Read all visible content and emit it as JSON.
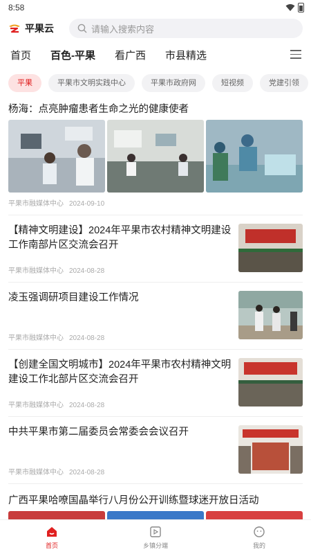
{
  "status": {
    "time": "8:58"
  },
  "app": {
    "name": "平果云"
  },
  "search": {
    "placeholder": "请输入搜索内容"
  },
  "nav_tabs": [
    {
      "label": "首页"
    },
    {
      "label": "百色-平果",
      "active": true
    },
    {
      "label": "看广西"
    },
    {
      "label": "市县精选"
    }
  ],
  "chips": [
    {
      "label": "平果",
      "active": true
    },
    {
      "label": "平果市文明实践中心"
    },
    {
      "label": "平果市政府网"
    },
    {
      "label": "短视频"
    },
    {
      "label": "党建引领"
    }
  ],
  "feed": {
    "featured": {
      "title": "杨海：点亮肿瘤患者生命之光的健康使者",
      "source": "平果市融媒体中心",
      "date": "2024-09-10"
    },
    "items": [
      {
        "title": "【精神文明建设】2024年平果市农村精神文明建设工作南部片区交流会召开",
        "source": "平果市融媒体中心",
        "date": "2024-08-28"
      },
      {
        "title": "凌玉强调研项目建设工作情况",
        "source": "平果市融媒体中心",
        "date": "2024-08-28"
      },
      {
        "title": "【创建全国文明城市】2024年平果市农村精神文明建设工作北部片区交流会召开",
        "source": "平果市融媒体中心",
        "date": "2024-08-28"
      },
      {
        "title": "中共平果市第二届委员会常委会会议召开",
        "source": "平果市融媒体中心",
        "date": "2024-08-28"
      }
    ],
    "last": {
      "title": "广西平果哈嘹国晶举行八月份公开训练暨球迷开放日活动"
    }
  },
  "bottom_nav": [
    {
      "label": "首页",
      "active": true
    },
    {
      "label": "乡镇分端"
    },
    {
      "label": "我的"
    }
  ],
  "colors": {
    "accent": "#e02020",
    "chip_active_bg": "#fde2e2"
  }
}
